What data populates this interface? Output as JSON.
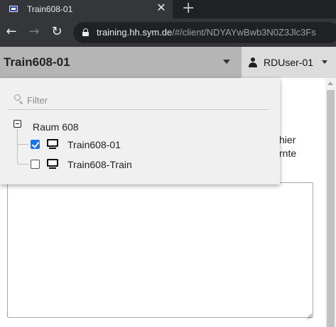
{
  "browser": {
    "tab_title": "Train608-01",
    "url_host": "training.hh.sym.de",
    "url_path": "/#/client/NDYAYwBwb3N0Z3Jlc3Fs",
    "close_glyph": "✕",
    "new_tab_glyph": "+",
    "back_glyph": "←",
    "forward_glyph": "→",
    "reload_glyph": "↻"
  },
  "header": {
    "client_name": "Train608-01",
    "user_name": "RDUser-01"
  },
  "content": {
    "behind_text_line1": "hier",
    "behind_text_line2": "rnte"
  },
  "dropdown": {
    "filter_placeholder": "Filter",
    "filter_value": "",
    "group_label": "Raum 608",
    "items": [
      {
        "label": "Train608-01",
        "checked": true,
        "icon": "monitor-icon"
      },
      {
        "label": "Train608-Train",
        "checked": false,
        "icon": "monitor-icon"
      }
    ]
  },
  "colors": {
    "browser_frame": "#202124",
    "browser_toolbar": "#35363a",
    "app_header": "#b5b5b5",
    "user_box": "#dcdcdc",
    "dropdown_bg": "#f0f0f0",
    "checkbox_checked": "#1a73e8"
  }
}
